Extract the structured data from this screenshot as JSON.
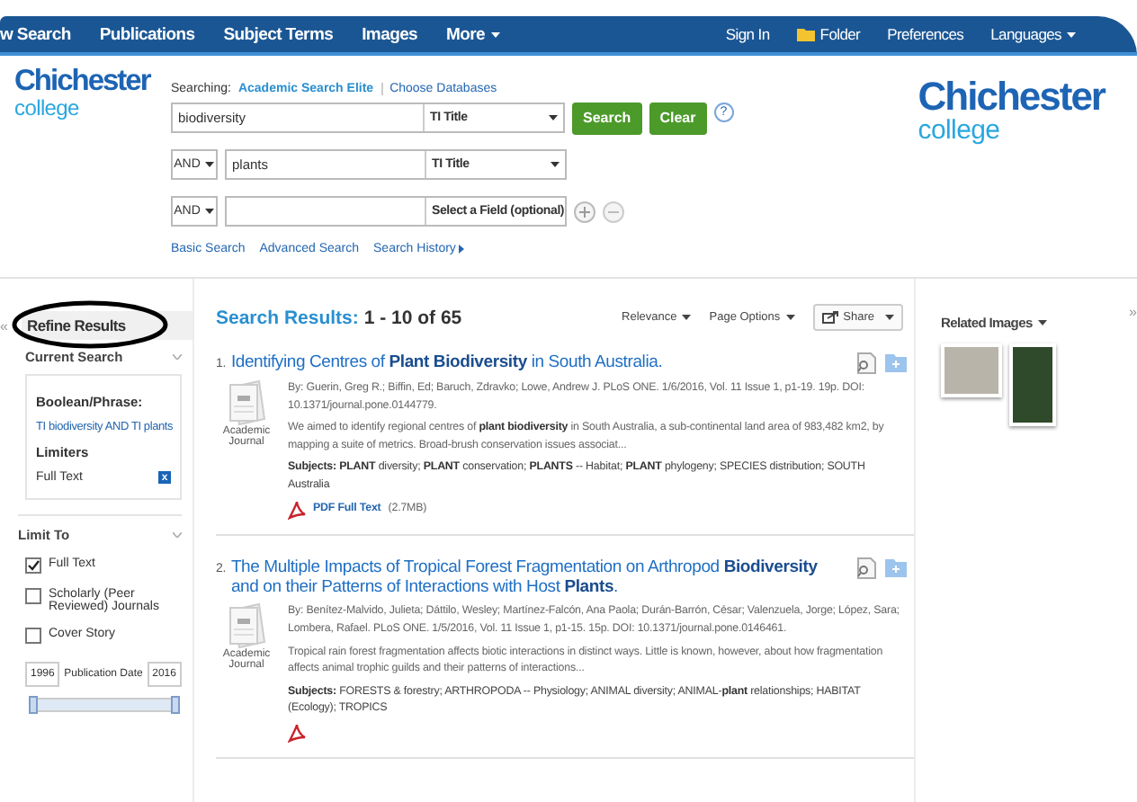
{
  "nav": {
    "left": [
      {
        "label": "w Search",
        "kind": "plain"
      },
      {
        "label": "Publications",
        "kind": "plain"
      },
      {
        "label": "Subject Terms",
        "kind": "plain"
      },
      {
        "label": "Images",
        "kind": "plain"
      },
      {
        "label": "More",
        "kind": "menu"
      }
    ],
    "right": [
      {
        "label": "Sign In",
        "kind": "plain"
      },
      {
        "label": "Folder",
        "kind": "folder"
      },
      {
        "label": "Preferences",
        "kind": "plain"
      },
      {
        "label": "Languages",
        "kind": "menu"
      }
    ]
  },
  "logos": [
    {
      "name": "Chichester",
      "sub": "college"
    },
    {
      "name": "Chichester",
      "sub": "college"
    }
  ],
  "search": {
    "searching_label": "Searching:",
    "database": "Academic Search Elite",
    "choose": "Choose Databases",
    "rows": [
      {
        "value": "biodiversity",
        "field": "TI Title"
      },
      {
        "operator": "AND",
        "value": "plants",
        "field": "TI Title"
      },
      {
        "operator": "AND",
        "field": "Select a Field (optional)"
      }
    ],
    "buttons": [
      "Search",
      "Clear"
    ],
    "help": "?",
    "links": [
      "Basic Search",
      "Advanced Search",
      "Search History"
    ]
  },
  "refine": {
    "collapse": "«",
    "title": "Refine Results",
    "annotation": {
      "kind": "ellipse"
    },
    "current_search": {
      "heading": "Current Search",
      "boolean_label": "Boolean/Phrase:",
      "boolean_value": "TI biodiversity AND TI plants",
      "limiters_label": "Limiters",
      "limiters": [
        {
          "label": "Full Text",
          "remove": "x"
        }
      ]
    },
    "limit_to": {
      "heading": "Limit To",
      "options": [
        {
          "label": "Full Text",
          "checked": true
        },
        {
          "label": "Scholarly (Peer Reviewed) Journals",
          "checked": false
        },
        {
          "label": "Cover Story",
          "checked": false
        }
      ],
      "date_from": "1996",
      "date_label": "Publication Date",
      "date_to": "2016",
      "date_range": {
        "level": 1
      }
    }
  },
  "results": {
    "heading": "Search Results:",
    "range": "1 - 10 of 65",
    "sort": "Relevance",
    "page_options": "Page Options",
    "share": "Share",
    "items": [
      {
        "number": "1.",
        "title": "Identifying Centres of **Plant Biodiversity** in South Australia.",
        "type": "Academic Journal",
        "byline": "By: Guerin, Greg R.; Biffin, Ed; Baruch, Zdravko; Lowe, Andrew J. PLoS ONE. 1/6/2016, Vol. 11 Issue 1, p1-19. 19p. DOI: 10.1371/journal.pone.0144779.",
        "abstract": "We aimed to identify regional centres of **plant biodiversity** in South Australia, a sub-continental land area of 983,482 km2, by mapping a suite of metrics. Broad-brush conservation issues associat...",
        "subjects": "**Subjects: PLANT** diversity; **PLANT** conservation; **PLANTS** -- Habitat; **PLANT** phylogeny; SPECIES distribution; SOUTH Australia",
        "pdf_link": "PDF Full Text",
        "pdf_size": "(2.7MB)",
        "pdf_icon": true
      },
      {
        "number": "2.",
        "title": "The Multiple Impacts of Tropical Forest Fragmentation on Arthropod **Biodiversity** and on their Patterns of Interactions with Host **Plants**.",
        "type": "Academic Journal",
        "byline": "By: Benítez-Malvido, Julieta; Dáttilo, Wesley; Martínez-Falcón, Ana Paola; Durán-Barrón, César; Valenzuela, Jorge; López, Sara; Lombera, Rafael. PLoS ONE. 1/5/2016, Vol. 11 Issue 1, p1-15. 15p. DOI: 10.1371/journal.pone.0146461.",
        "abstract": "Tropical rain forest fragmentation affects biotic interactions in distinct ways. Little is known, however, about how fragmentation affects animal trophic guilds and their patterns of interactions...",
        "subjects": "**Subjects:** FORESTS & forestry; ARTHROPODA -- Physiology; ANIMAL diversity; ANIMAL-**plant** relationships; HABITAT (Ecology); TROPICS",
        "pdf_icon": true
      }
    ]
  },
  "related": {
    "heading": "Related Images",
    "images": [
      {
        "kind": "photo"
      },
      {
        "kind": "photo"
      }
    ],
    "expand": "»"
  }
}
